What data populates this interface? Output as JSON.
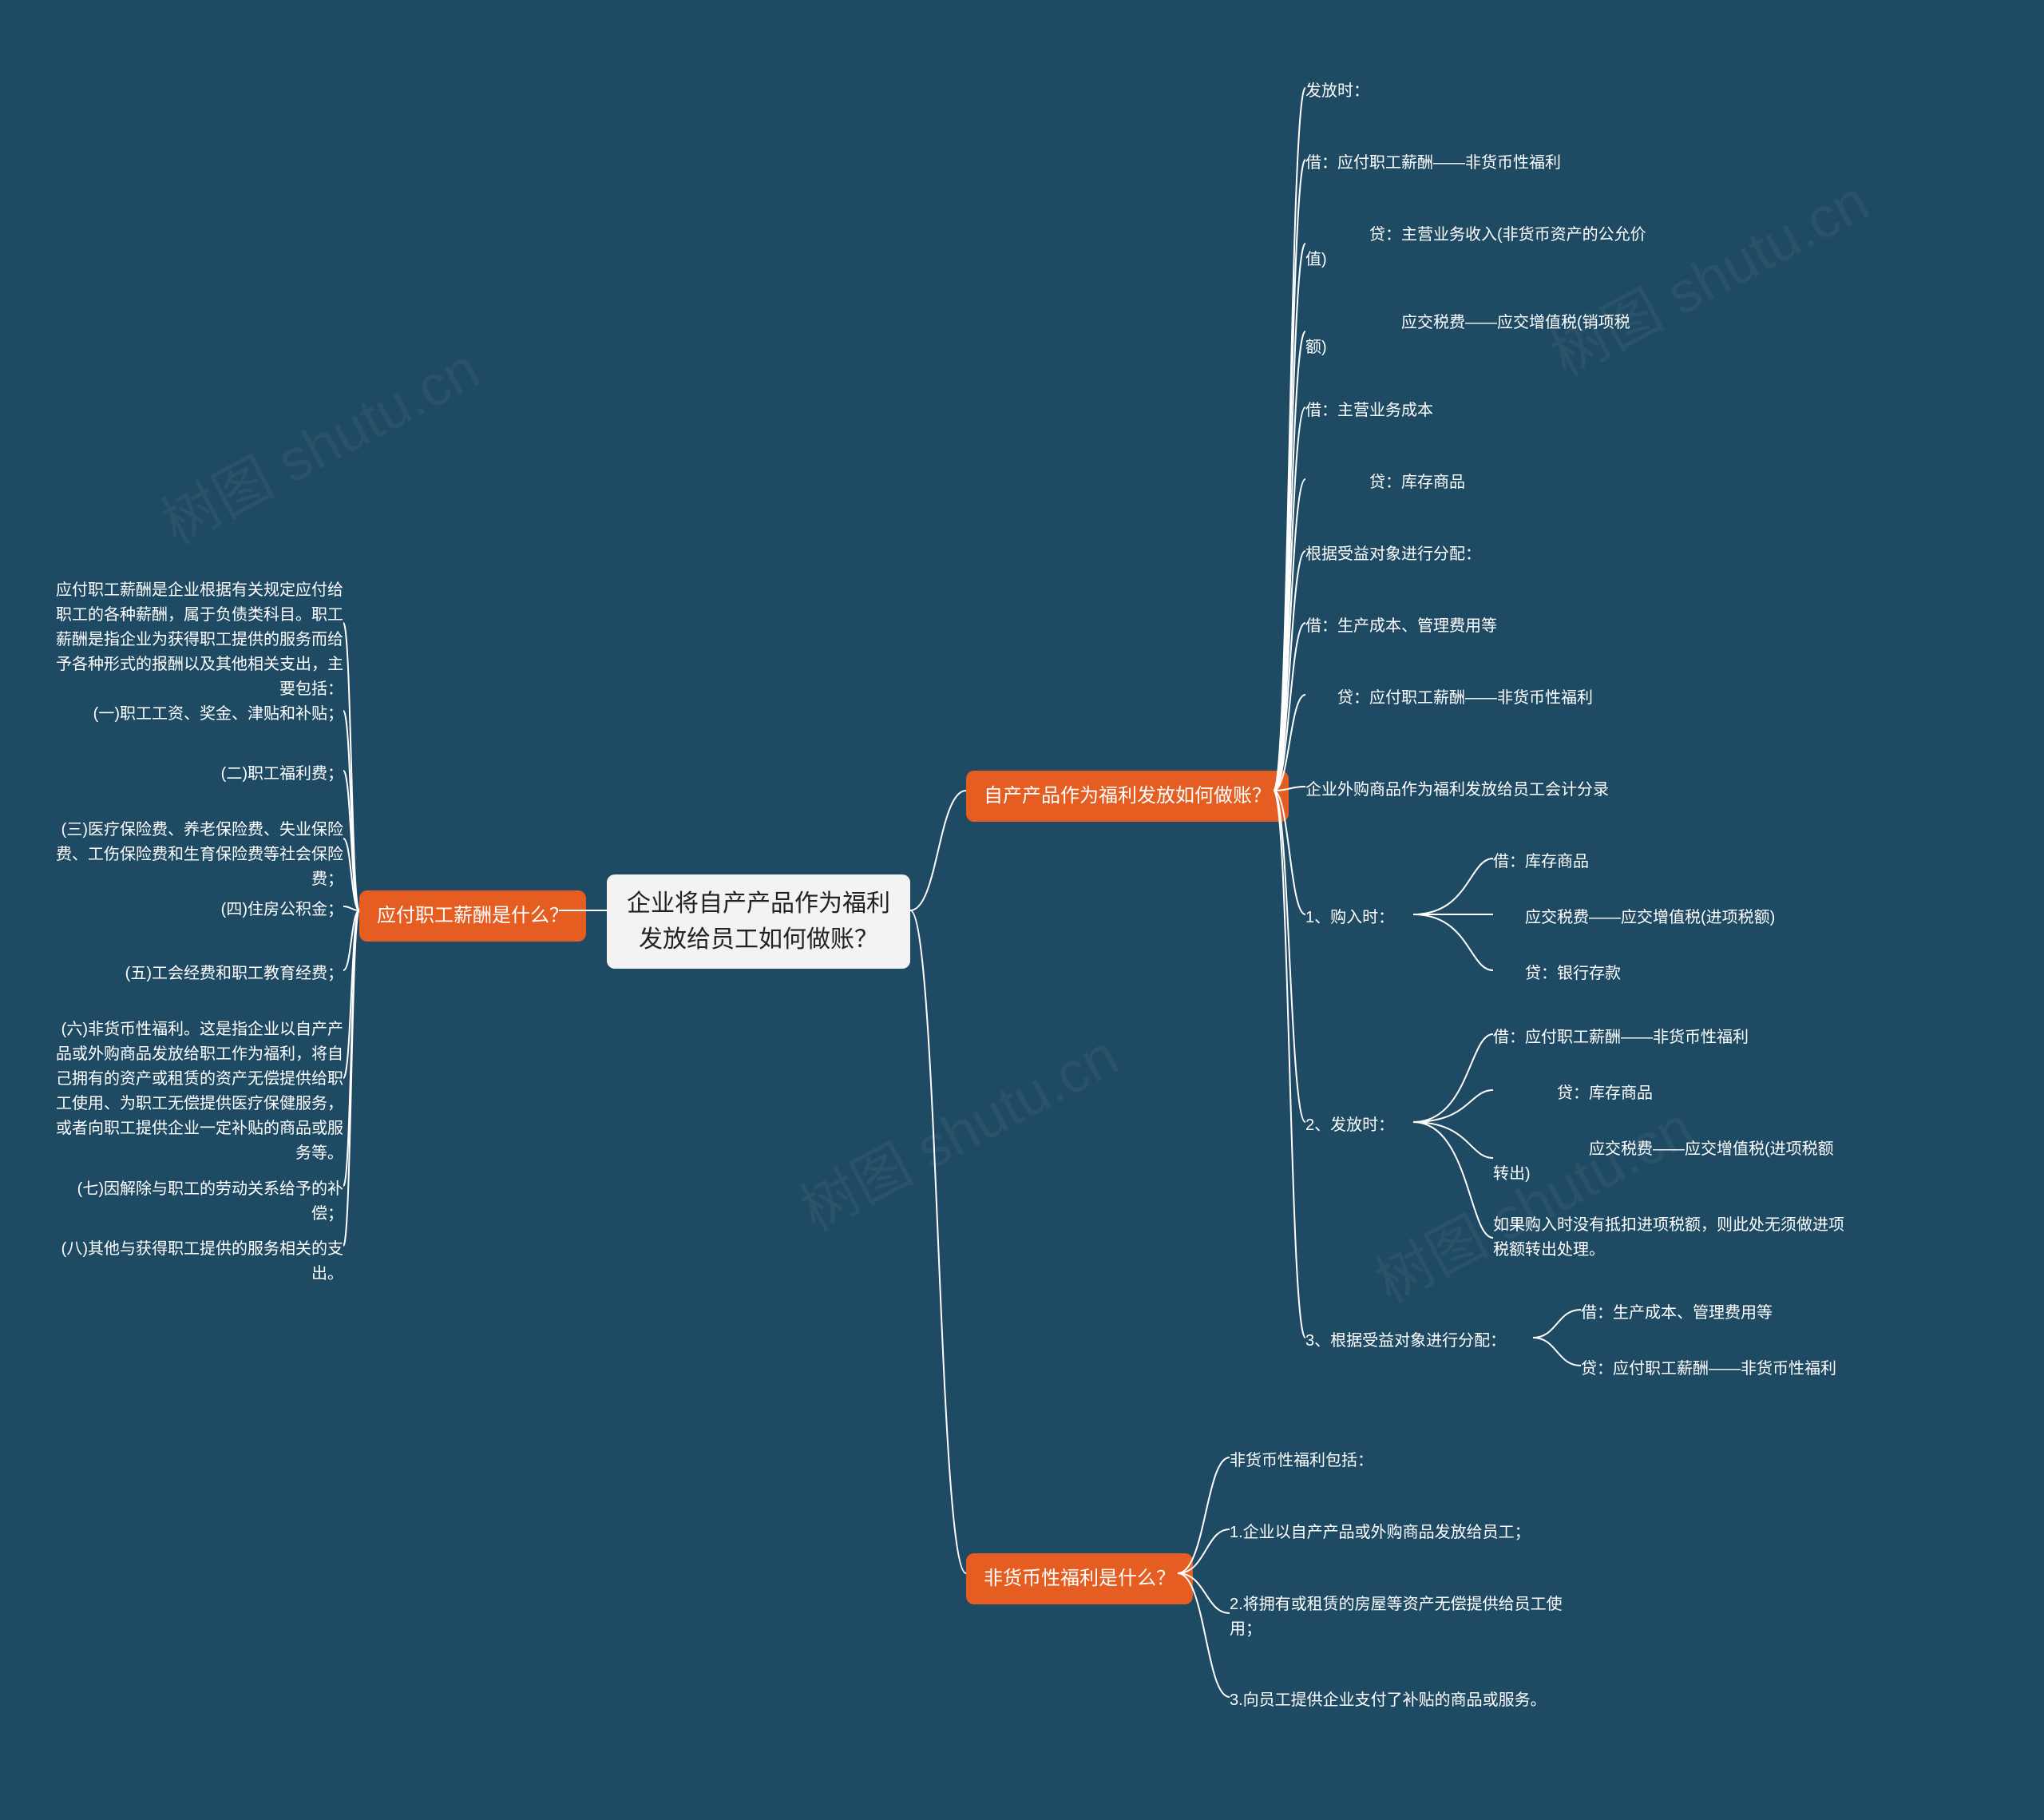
{
  "watermarks": [
    "树图 shutu.cn",
    "树图 shutu.cn",
    "树图 shutu.cn",
    "树图 shutu.cn"
  ],
  "center": "企业将自产产品作为福利\n发放给员工如何做账？",
  "left": {
    "title": "应付职工薪酬是什么？",
    "items": [
      "应付职工薪酬是企业根据有关规定应付给职工的各种薪酬，属于负债类科目。职工薪酬是指企业为获得职工提供的服务而给予各种形式的报酬以及其他相关支出，主要包括：",
      "(一)职工工资、奖金、津贴和补贴；",
      "(二)职工福利费；",
      "(三)医疗保险费、养老保险费、失业保险费、工伤保险费和生育保险费等社会保险费；",
      "(四)住房公积金；",
      "(五)工会经费和职工教育经费；",
      "(六)非货币性福利。这是指企业以自产产品或外购商品发放给职工作为福利，将自己拥有的资产或租赁的资产无偿提供给职工使用、为职工无偿提供医疗保健服务，或者向职工提供企业一定补贴的商品或服务等。",
      "(七)因解除与职工的劳动关系给予的补偿；",
      "(八)其他与获得职工提供的服务相关的支出。"
    ]
  },
  "rightA": {
    "title": "自产产品作为福利发放如何做账？",
    "top": [
      "发放时：",
      "借：应付职工薪酬——非货币性福利",
      "　　　　贷：主营业务收入(非货币资产的公允价值)",
      "　　　　　　应交税费——应交增值税(销项税额)",
      "借：主营业务成本",
      "　　　　贷：库存商品",
      "根据受益对象进行分配：",
      "借：生产成本、管理费用等",
      "　　贷：应付职工薪酬——非货币性福利",
      "企业外购商品作为福利发放给员工会计分录"
    ],
    "sub1": {
      "label": "1、购入时：",
      "items": [
        "借：库存商品",
        "　　应交税费——应交增值税(进项税额)",
        "　　贷：银行存款"
      ]
    },
    "sub2": {
      "label": "2、发放时：",
      "items": [
        "借：应付职工薪酬——非货币性福利",
        "　　　　贷：库存商品",
        "　　　　　　应交税费——应交增值税(进项税额转出)",
        "如果购入时没有抵扣进项税额，则此处无须做进项税额转出处理。"
      ]
    },
    "sub3": {
      "label": "3、根据受益对象进行分配：",
      "items": [
        "借：生产成本、管理费用等",
        "贷：应付职工薪酬——非货币性福利"
      ]
    }
  },
  "rightB": {
    "title": "非货币性福利是什么？",
    "items": [
      "非货币性福利包括：",
      "1.企业以自产产品或外购商品发放给员工；",
      "2.将拥有或租赁的房屋等资产无偿提供给员工使用；",
      "3.向员工提供企业支付了补贴的商品或服务。"
    ]
  }
}
